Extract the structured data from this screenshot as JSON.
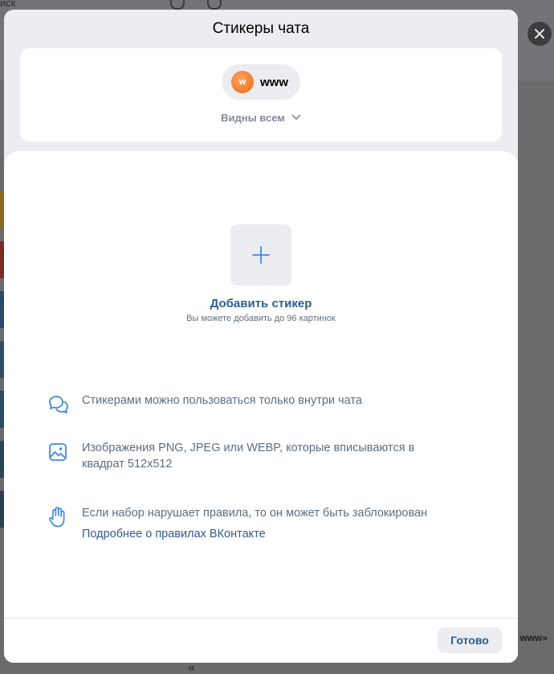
{
  "background": {
    "hint_text": "иск",
    "right_text": "www»",
    "bottom_chev": "«"
  },
  "modal": {
    "title": "Стикеры чата",
    "chat": {
      "avatar_letter": "w",
      "name": "www",
      "visibility": "Видны всем"
    },
    "add": {
      "title": "Добавить стикер",
      "subtitle": "Вы можете добавить до 96 картинок"
    },
    "rules": [
      {
        "icon": "chat-bubbles-icon",
        "text": "Стикерами можно пользоваться только внутри чата"
      },
      {
        "icon": "image-icon",
        "text": "Изображения PNG, JPEG или WEBP, которые вписываются в квадрат 512x512"
      },
      {
        "icon": "hand-stop-icon",
        "text": "Если набор нарушает правила, то он может быть заблокирован",
        "link": "Подробнее о правилах ВКонтакте"
      }
    ],
    "done_label": "Готово"
  },
  "colors": {
    "accent": "#2d5d8f",
    "icon_blue": "#3f8ae0",
    "secondary_text": "#626d7a",
    "modal_bg": "#ebedf0"
  }
}
